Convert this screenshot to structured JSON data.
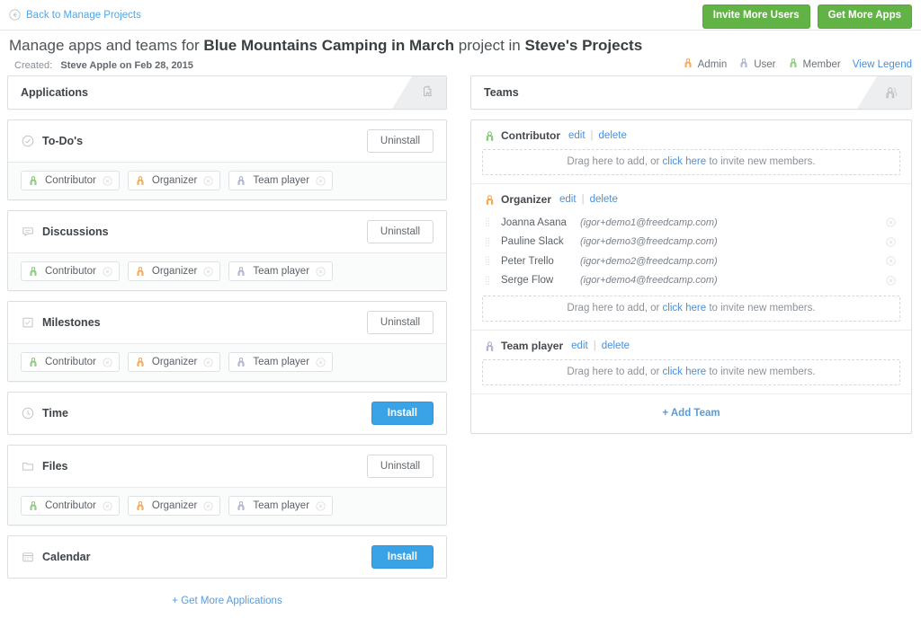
{
  "topbar": {
    "back_label": "Back to Manage Projects",
    "invite_users_label": "Invite More Users",
    "get_apps_label": "Get More Apps"
  },
  "heading": {
    "prefix": "Manage apps and teams for ",
    "project_name": "Blue Mountains Camping in March",
    "middle": " project in ",
    "workspace": "Steve's Projects",
    "created_label": "Created:",
    "created_value": "Steve Apple on Feb 28, 2015"
  },
  "legend": {
    "items": [
      {
        "label": "Admin",
        "color": "#f0922b"
      },
      {
        "label": "User",
        "color": "#9aa0c5"
      },
      {
        "label": "Member",
        "color": "#6bbd5b"
      }
    ],
    "view_legend_label": "View Legend"
  },
  "applications": {
    "panel_title": "Applications",
    "panel_icon": "puzzle-piece-icon",
    "footer_link": "+ Get More Applications",
    "apps": [
      {
        "name": "To-Do's",
        "icon": "check-circle-icon",
        "action": "Uninstall",
        "installed": true,
        "tags": [
          {
            "label": "Contributor",
            "color": "#6bbd5b"
          },
          {
            "label": "Organizer",
            "color": "#f0922b"
          },
          {
            "label": "Team player",
            "color": "#9aa0c5"
          }
        ]
      },
      {
        "name": "Discussions",
        "icon": "speech-bubble-icon",
        "action": "Uninstall",
        "installed": true,
        "tags": [
          {
            "label": "Contributor",
            "color": "#6bbd5b"
          },
          {
            "label": "Organizer",
            "color": "#f0922b"
          },
          {
            "label": "Team player",
            "color": "#9aa0c5"
          }
        ]
      },
      {
        "name": "Milestones",
        "icon": "checked-square-icon",
        "action": "Uninstall",
        "installed": true,
        "tags": [
          {
            "label": "Contributor",
            "color": "#6bbd5b"
          },
          {
            "label": "Organizer",
            "color": "#f0922b"
          },
          {
            "label": "Team player",
            "color": "#9aa0c5"
          }
        ]
      },
      {
        "name": "Time",
        "icon": "clock-icon",
        "action": "Install",
        "installed": false,
        "tags": []
      },
      {
        "name": "Files",
        "icon": "folder-icon",
        "action": "Uninstall",
        "installed": true,
        "tags": [
          {
            "label": "Contributor",
            "color": "#6bbd5b"
          },
          {
            "label": "Organizer",
            "color": "#f0922b"
          },
          {
            "label": "Team player",
            "color": "#9aa0c5"
          }
        ]
      },
      {
        "name": "Calendar",
        "icon": "calendar-icon",
        "action": "Install",
        "installed": false,
        "tags": []
      }
    ]
  },
  "teams": {
    "panel_title": "Teams",
    "panel_icon": "people-group-icon",
    "edit_label": "edit",
    "delete_label": "delete",
    "separator": "|",
    "dropzone_prefix": "Drag here to add, or ",
    "dropzone_link": "click here",
    "dropzone_suffix": " to invite new members.",
    "add_team_label": "+ Add Team",
    "groups": [
      {
        "name": "Contributor",
        "color": "#6bbd5b",
        "members": []
      },
      {
        "name": "Organizer",
        "color": "#f0922b",
        "members": [
          {
            "name": "Joanna Asana",
            "email": "(igor+demo1@freedcamp.com)"
          },
          {
            "name": "Pauline Slack",
            "email": "(igor+demo3@freedcamp.com)"
          },
          {
            "name": "Peter Trello",
            "email": "(igor+demo2@freedcamp.com)"
          },
          {
            "name": "Serge Flow",
            "email": "(igor+demo4@freedcamp.com)"
          }
        ]
      },
      {
        "name": "Team player",
        "color": "#9aa0c5",
        "members": []
      }
    ]
  },
  "colors": {
    "green_button": "#62b345",
    "blue_button": "#3aa3e8",
    "link_blue": "#4a90d9",
    "admin_orange": "#f0922b",
    "user_gray": "#9aa0c5",
    "member_green": "#6bbd5b"
  }
}
